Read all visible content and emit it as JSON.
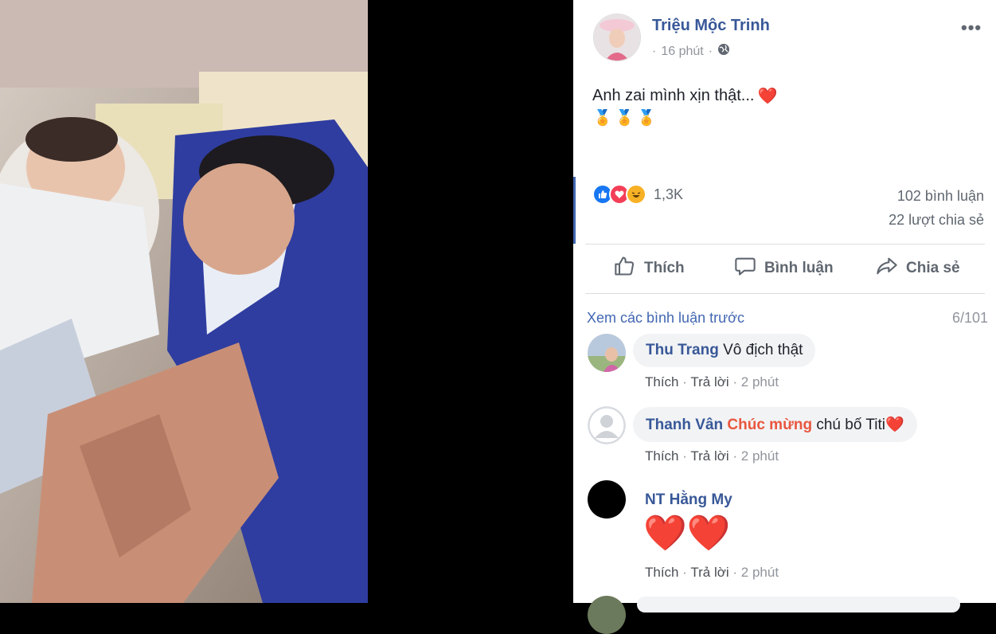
{
  "post": {
    "author": "Triệu Mộc Trinh",
    "time": "16 phút",
    "separator": "·",
    "privacy_icon": "globe-icon",
    "text": "Anh zai mình xịn thật...",
    "heart_emoji": "❤️",
    "medal_emojis": [
      "🏅",
      "🏅",
      "🏅"
    ]
  },
  "stats": {
    "reaction_icons": [
      "like-icon",
      "love-icon",
      "haha-icon"
    ],
    "reaction_count": "1,3K",
    "comments": "102 bình luận",
    "shares": "22 lượt chia sẻ"
  },
  "actions": {
    "like": "Thích",
    "comment": "Bình luận",
    "share": "Chia sẻ"
  },
  "comments_header": {
    "view_previous": "Xem các bình luận trước",
    "count": "6/101"
  },
  "comments": [
    {
      "name": "Thu Trang",
      "text": "Vô địch thật",
      "like": "Thích",
      "reply": "Trả lời",
      "sep": "·",
      "time": "2 phút"
    },
    {
      "name": "Thanh Vân",
      "highlight": "Chúc mừng",
      "text": "chú bố Titi",
      "emoji": "❤️",
      "like": "Thích",
      "reply": "Trả lời",
      "sep": "·",
      "time": "2 phút"
    },
    {
      "name": "NT Hằng My",
      "emoji": "❤️❤️",
      "like": "Thích",
      "reply": "Trả lời",
      "sep": "·",
      "time": "2 phút"
    }
  ],
  "colors": {
    "link": "#385898",
    "accent": "#4267b2",
    "muted": "#90949c",
    "heart": "#e0245e",
    "bubble": "#f2f3f5"
  }
}
